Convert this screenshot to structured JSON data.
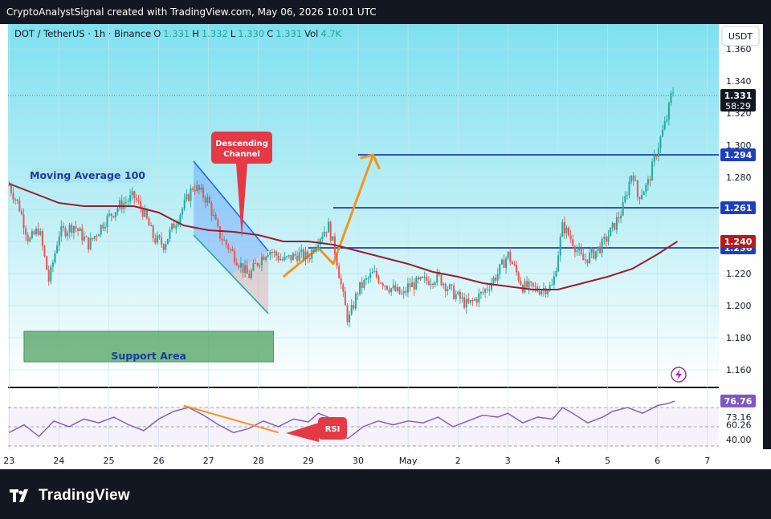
{
  "header": {
    "attribution": "CryptoAnalystSignal created with TradingView.com, May 06, 2026 10:01 UTC"
  },
  "legend": {
    "symbol": "DOT / TetherUS · 1h · Binance",
    "o_label": "O",
    "o_value": "1.331",
    "h_label": "H",
    "h_value": "1.332",
    "l_label": "L",
    "l_value": "1.330",
    "c_label": "C",
    "c_value": "1.331",
    "vol_label": "Vol",
    "vol_value": "4.7K"
  },
  "currency_button": "USDT",
  "brand": {
    "name": "TradingView"
  },
  "colors": {
    "up": "#26a69a",
    "down": "#ef5350",
    "ma": "#9c1c2c",
    "level": "#1d3fbf",
    "orange": "#f7931a",
    "rsi": "#7e57c2",
    "support": "#5aa86a",
    "price_tag_bg": "#131722",
    "bg_top": "#7fe0f0",
    "bg_bottom": "#ffffff"
  },
  "annotations": {
    "moving_average": "Moving Average 100",
    "descending_channel_line1": "Descending",
    "descending_channel_line2": "Channel",
    "support_area": "Support Area",
    "rsi": "RSI"
  },
  "chart_data": [
    {
      "type": "candlestick",
      "title": "DOT / TetherUS · 1h · Binance",
      "x_axis_labels": [
        "23",
        "24",
        "25",
        "26",
        "27",
        "28",
        "29",
        "30",
        "May",
        "2",
        "3",
        "4",
        "5",
        "6",
        "7"
      ],
      "y_axis_ticks": [
        "1.360",
        "1.340",
        "1.320",
        "1.300",
        "1.280",
        "1.260",
        "1.240",
        "1.220",
        "1.200",
        "1.180",
        "1.160"
      ],
      "ylim": [
        1.15,
        1.37
      ],
      "current_price": "1.331",
      "countdown": "58:29",
      "price_path": [
        [
          "23",
          1.275
        ],
        [
          "23.2",
          1.262
        ],
        [
          "23.4",
          1.24
        ],
        [
          "23.6",
          1.248
        ],
        [
          "23.8",
          1.215
        ],
        [
          "24",
          1.245
        ],
        [
          "24.3",
          1.25
        ],
        [
          "24.6",
          1.238
        ],
        [
          "24.9",
          1.252
        ],
        [
          "25.2",
          1.262
        ],
        [
          "25.5",
          1.268
        ],
        [
          "25.7",
          1.258
        ],
        [
          "25.9",
          1.242
        ],
        [
          "26.1",
          1.238
        ],
        [
          "26.3",
          1.25
        ],
        [
          "26.5",
          1.262
        ],
        [
          "26.7",
          1.275
        ],
        [
          "27",
          1.265
        ],
        [
          "27.2",
          1.245
        ],
        [
          "27.5",
          1.232
        ],
        [
          "27.8",
          1.218
        ],
        [
          "28",
          1.228
        ],
        [
          "28.2",
          1.235
        ],
        [
          "28.5",
          1.228
        ],
        [
          "28.8",
          1.232
        ],
        [
          "29",
          1.23
        ],
        [
          "29.2",
          1.242
        ],
        [
          "29.4",
          1.25
        ],
        [
          "29.55",
          1.232
        ],
        [
          "29.7",
          1.205
        ],
        [
          "29.8",
          1.19
        ],
        [
          "30",
          1.21
        ],
        [
          "30.3",
          1.22
        ],
        [
          "30.6",
          1.212
        ],
        [
          "30.9",
          1.206
        ],
        [
          "May",
          1.212
        ],
        [
          "1.3",
          1.215
        ],
        [
          "1.6",
          1.218
        ],
        [
          "1.9",
          1.208
        ],
        [
          "2.2",
          1.2
        ],
        [
          "2.5",
          1.208
        ],
        [
          "2.8",
          1.22
        ],
        [
          "3",
          1.232
        ],
        [
          "3.3",
          1.212
        ],
        [
          "3.6",
          1.21
        ],
        [
          "3.9",
          1.212
        ],
        [
          "4.1",
          1.25
        ],
        [
          "4.3",
          1.24
        ],
        [
          "4.5",
          1.228
        ],
        [
          "4.7",
          1.232
        ],
        [
          "4.9",
          1.238
        ],
        [
          "5.1",
          1.248
        ],
        [
          "5.3",
          1.26
        ],
        [
          "5.5",
          1.285
        ],
        [
          "5.6",
          1.268
        ],
        [
          "5.8",
          1.275
        ],
        [
          "6",
          1.298
        ],
        [
          "6.1",
          1.308
        ],
        [
          "6.2",
          1.318
        ],
        [
          "6.3",
          1.335
        ],
        [
          "6.35",
          1.331
        ]
      ],
      "series": [
        {
          "name": "Moving Average 100",
          "points": [
            [
              "23",
              1.276
            ],
            [
              "23.5",
              1.27
            ],
            [
              "24",
              1.264
            ],
            [
              "24.5",
              1.262
            ],
            [
              "25",
              1.262
            ],
            [
              "25.5",
              1.262
            ],
            [
              "26",
              1.258
            ],
            [
              "26.5",
              1.25
            ],
            [
              "27",
              1.247
            ],
            [
              "27.5",
              1.246
            ],
            [
              "28",
              1.244
            ],
            [
              "28.5",
              1.24
            ],
            [
              "29",
              1.24
            ],
            [
              "29.5",
              1.238
            ],
            [
              "30",
              1.234
            ],
            [
              "30.5",
              1.23
            ],
            [
              "May",
              1.226
            ],
            [
              "1.5",
              1.221
            ],
            [
              "2",
              1.218
            ],
            [
              "2.5",
              1.214
            ],
            [
              "3",
              1.212
            ],
            [
              "3.5",
              1.21
            ],
            [
              "4",
              1.21
            ],
            [
              "4.5",
              1.214
            ],
            [
              "5",
              1.218
            ],
            [
              "5.5",
              1.223
            ],
            [
              "6",
              1.232
            ],
            [
              "6.4",
              1.24
            ]
          ]
        }
      ],
      "horizontal_levels": [
        {
          "value": 1.294,
          "label": "1.294"
        },
        {
          "value": 1.261,
          "label": "1.261"
        },
        {
          "value": 1.236,
          "label": "1.236"
        }
      ],
      "price_tags": [
        {
          "value": 1.24,
          "label": "1.240"
        }
      ],
      "support_area": {
        "from": 1.16,
        "to": 1.18,
        "x_from": "23.3",
        "x_to": "28.3"
      },
      "descending_channel": {
        "x_from": "26.7",
        "x_to": "28.2",
        "upper_from": 1.29,
        "upper_to": 1.234,
        "lower_from": 1.244,
        "lower_to": 1.195
      }
    },
    {
      "type": "line",
      "title": "RSI",
      "y_axis_ticks": [
        "76.76",
        "73.16",
        "60.26",
        "40.00"
      ],
      "ylim": [
        30,
        80
      ],
      "levels": [
        70,
        50,
        30
      ],
      "series": [
        {
          "name": "RSI",
          "points": [
            [
              "23",
              44
            ],
            [
              "23.3",
              52
            ],
            [
              "23.6",
              40
            ],
            [
              "23.9",
              56
            ],
            [
              "24.2",
              50
            ],
            [
              "24.5",
              58
            ],
            [
              "24.8",
              54
            ],
            [
              "25.1",
              60
            ],
            [
              "25.4",
              52
            ],
            [
              "25.7",
              46
            ],
            [
              "26",
              58
            ],
            [
              "26.3",
              66
            ],
            [
              "26.6",
              70
            ],
            [
              "26.9",
              62
            ],
            [
              "27.2",
              52
            ],
            [
              "27.5",
              44
            ],
            [
              "27.8",
              48
            ],
            [
              "28.1",
              56
            ],
            [
              "28.4",
              50
            ],
            [
              "28.7",
              58
            ],
            [
              "29",
              55
            ],
            [
              "29.2",
              64
            ],
            [
              "29.4",
              60
            ],
            [
              "29.6",
              40
            ],
            [
              "29.8",
              38
            ],
            [
              "30.1",
              50
            ],
            [
              "30.4",
              56
            ],
            [
              "30.7",
              52
            ],
            [
              "May",
              56
            ],
            [
              "1.3",
              54
            ],
            [
              "1.6",
              60
            ],
            [
              "1.9",
              50
            ],
            [
              "2.2",
              56
            ],
            [
              "2.5",
              62
            ],
            [
              "2.8",
              60
            ],
            [
              "3",
              64
            ],
            [
              "3.3",
              54
            ],
            [
              "3.6",
              60
            ],
            [
              "3.9",
              58
            ],
            [
              "4.1",
              70
            ],
            [
              "4.3",
              64
            ],
            [
              "4.6",
              54
            ],
            [
              "4.9",
              60
            ],
            [
              "5.1",
              66
            ],
            [
              "5.4",
              70
            ],
            [
              "5.7",
              64
            ],
            [
              "6",
              72
            ],
            [
              "6.2",
              74
            ],
            [
              "6.35",
              76.76
            ]
          ]
        }
      ]
    }
  ]
}
